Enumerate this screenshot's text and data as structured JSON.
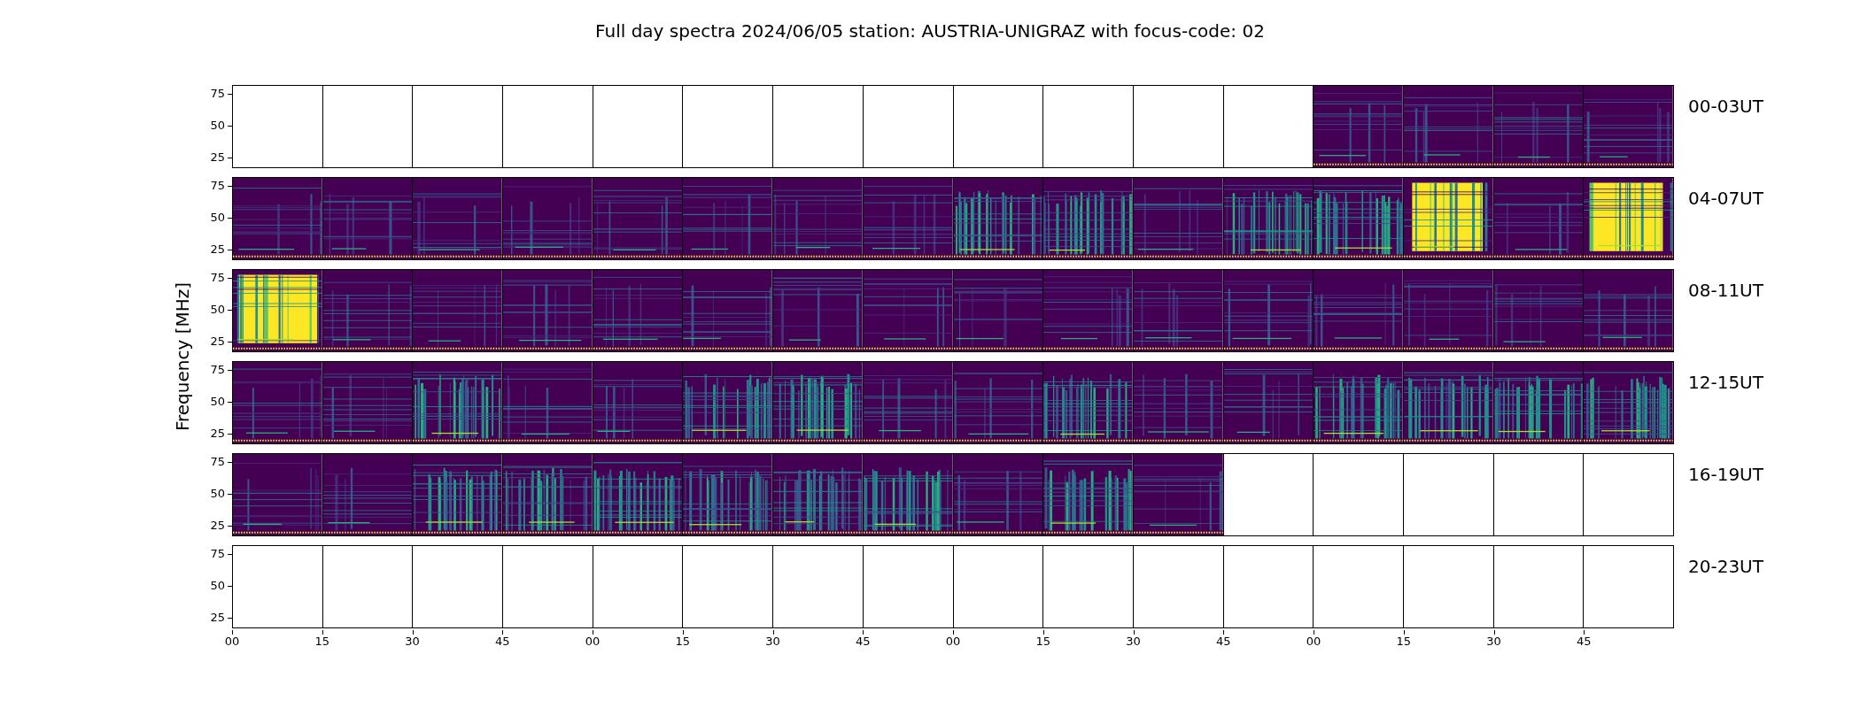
{
  "title": "Full day spectra 2024/06/05 station: AUSTRIA-UNIGRAZ with focus-code: 02",
  "ylabel": "Frequency [MHz]",
  "rows": [
    {
      "label": "00-03UT",
      "yticks": [
        "75",
        "50",
        "25"
      ],
      "panels": [
        {
          "kind": "empty"
        },
        {
          "kind": "empty"
        },
        {
          "kind": "empty"
        },
        {
          "kind": "empty"
        },
        {
          "kind": "empty"
        },
        {
          "kind": "empty"
        },
        {
          "kind": "empty"
        },
        {
          "kind": "empty"
        },
        {
          "kind": "empty"
        },
        {
          "kind": "empty"
        },
        {
          "kind": "empty"
        },
        {
          "kind": "empty"
        },
        {
          "kind": "quiet"
        },
        {
          "kind": "quiet"
        },
        {
          "kind": "quiet"
        },
        {
          "kind": "quiet"
        }
      ]
    },
    {
      "label": "04-07UT",
      "yticks": [
        "75",
        "50",
        "25"
      ],
      "panels": [
        {
          "kind": "quiet"
        },
        {
          "kind": "quiet"
        },
        {
          "kind": "quiet"
        },
        {
          "kind": "quiet"
        },
        {
          "kind": "quiet"
        },
        {
          "kind": "quiet"
        },
        {
          "kind": "quiet"
        },
        {
          "kind": "quiet"
        },
        {
          "kind": "mixed"
        },
        {
          "kind": "mixed"
        },
        {
          "kind": "quiet"
        },
        {
          "kind": "mixed"
        },
        {
          "kind": "mixed"
        },
        {
          "kind": "bright"
        },
        {
          "kind": "quiet"
        },
        {
          "kind": "bright"
        }
      ]
    },
    {
      "label": "08-11UT",
      "yticks": [
        "75",
        "50",
        "25"
      ],
      "panels": [
        {
          "kind": "bright"
        },
        {
          "kind": "quiet"
        },
        {
          "kind": "quiet"
        },
        {
          "kind": "quiet"
        },
        {
          "kind": "quiet"
        },
        {
          "kind": "quiet"
        },
        {
          "kind": "quiet"
        },
        {
          "kind": "quiet"
        },
        {
          "kind": "quiet"
        },
        {
          "kind": "quiet"
        },
        {
          "kind": "quiet"
        },
        {
          "kind": "quiet"
        },
        {
          "kind": "quiet"
        },
        {
          "kind": "quiet"
        },
        {
          "kind": "quiet"
        },
        {
          "kind": "quiet"
        }
      ]
    },
    {
      "label": "12-15UT",
      "yticks": [
        "75",
        "50",
        "25"
      ],
      "panels": [
        {
          "kind": "quiet"
        },
        {
          "kind": "quiet"
        },
        {
          "kind": "mixed"
        },
        {
          "kind": "quiet"
        },
        {
          "kind": "quiet"
        },
        {
          "kind": "mixed"
        },
        {
          "kind": "mixed"
        },
        {
          "kind": "quiet"
        },
        {
          "kind": "quiet"
        },
        {
          "kind": "mixed"
        },
        {
          "kind": "quiet"
        },
        {
          "kind": "quiet"
        },
        {
          "kind": "mixed"
        },
        {
          "kind": "mixed"
        },
        {
          "kind": "mixed"
        },
        {
          "kind": "mixed"
        }
      ]
    },
    {
      "label": "16-19UT",
      "yticks": [
        "75",
        "50",
        "25"
      ],
      "panels": [
        {
          "kind": "quiet"
        },
        {
          "kind": "quiet"
        },
        {
          "kind": "mixed"
        },
        {
          "kind": "mixed"
        },
        {
          "kind": "mixed"
        },
        {
          "kind": "mixed"
        },
        {
          "kind": "mixed"
        },
        {
          "kind": "mixed"
        },
        {
          "kind": "quiet"
        },
        {
          "kind": "mixed"
        },
        {
          "kind": "quiet"
        },
        {
          "kind": "empty"
        },
        {
          "kind": "empty"
        },
        {
          "kind": "empty"
        },
        {
          "kind": "empty"
        },
        {
          "kind": "empty"
        }
      ]
    },
    {
      "label": "20-23UT",
      "yticks": [
        "75",
        "50",
        "25"
      ],
      "panels": [
        {
          "kind": "empty"
        },
        {
          "kind": "empty"
        },
        {
          "kind": "empty"
        },
        {
          "kind": "empty"
        },
        {
          "kind": "empty"
        },
        {
          "kind": "empty"
        },
        {
          "kind": "empty"
        },
        {
          "kind": "empty"
        },
        {
          "kind": "empty"
        },
        {
          "kind": "empty"
        },
        {
          "kind": "empty"
        },
        {
          "kind": "empty"
        },
        {
          "kind": "empty"
        },
        {
          "kind": "empty"
        },
        {
          "kind": "empty"
        },
        {
          "kind": "empty"
        }
      ]
    }
  ],
  "xticks": [
    "00",
    "15",
    "30",
    "45",
    "00",
    "15",
    "30",
    "45",
    "00",
    "15",
    "30",
    "45",
    "00",
    "15",
    "30",
    "45"
  ]
}
